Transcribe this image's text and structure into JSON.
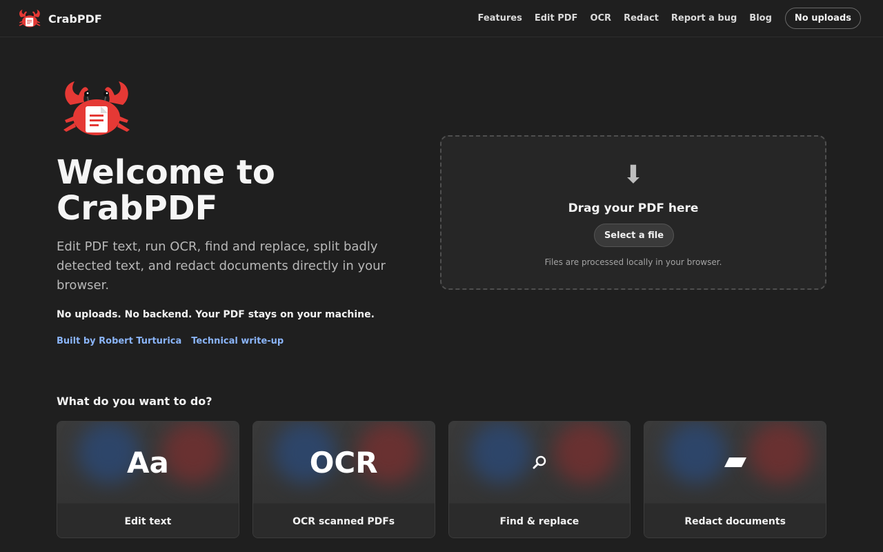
{
  "header": {
    "brand": "CrabPDF",
    "brand_icon": "crab-logo-icon",
    "nav": [
      "Features",
      "Edit PDF",
      "OCR",
      "Redact",
      "Report a bug",
      "Blog"
    ],
    "pill": "No uploads"
  },
  "hero": {
    "title": "Welcome to CrabPDF",
    "description": "Edit PDF text, run OCR, find and replace, split badly detected text, and redact documents directly in your browser.",
    "strong": "No uploads. No backend. Your PDF stays on your machine.",
    "links": [
      "Built by Robert Turturica",
      "Technical write-up"
    ]
  },
  "dropzone": {
    "icon": "download-arrow-icon",
    "title": "Drag your PDF here",
    "button": "Select a file",
    "note": "Files are processed locally in your browser."
  },
  "section": {
    "title": "What do you want to do?",
    "cards": [
      {
        "glyph": "Aa",
        "label": "Edit text"
      },
      {
        "glyph": "OCR",
        "label": "OCR scanned PDFs"
      },
      {
        "glyph_icon": "magnifier-icon",
        "label": "Find & replace"
      },
      {
        "glyph_icon": "redaction-bar-icon",
        "label": "Redact documents"
      }
    ]
  },
  "colors": {
    "background": "#1f1f1f",
    "crab_red": "#e53935",
    "link_blue": "#8ab4f8"
  }
}
